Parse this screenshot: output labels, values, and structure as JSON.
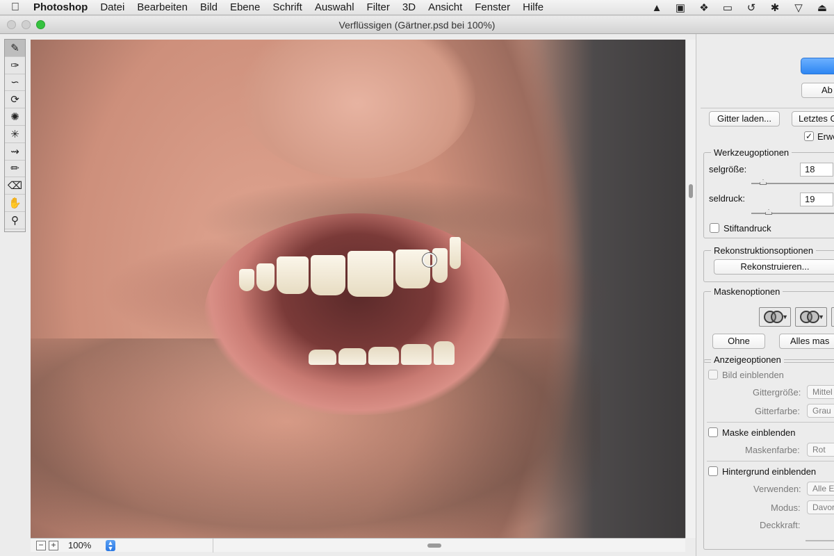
{
  "menubar": {
    "app_name": "Photoshop",
    "items": [
      "Datei",
      "Bearbeiten",
      "Bild",
      "Ebene",
      "Schrift",
      "Auswahl",
      "Filter",
      "3D",
      "Ansicht",
      "Fenster",
      "Hilfe"
    ],
    "status_icons": [
      "hat-icon",
      "display-icon",
      "dropbox-icon",
      "airplay-icon",
      "time-machine-icon",
      "bluetooth-icon",
      "wifi-icon",
      "eject-icon"
    ]
  },
  "window": {
    "title": "Verflüssigen (Gärtner.psd bei 100%)"
  },
  "toolbox": {
    "tools": [
      "forward-warp-tool-icon",
      "reconstruct-tool-icon",
      "smooth-tool-icon",
      "twirl-tool-icon",
      "pucker-tool-icon",
      "bloat-tool-icon",
      "push-left-tool-icon",
      "freeze-mask-tool-icon",
      "thaw-mask-tool-icon",
      "hand-tool-icon",
      "zoom-tool-icon"
    ]
  },
  "statusbar": {
    "zoom_minus": "−",
    "zoom_plus": "+",
    "zoom_value": "100%"
  },
  "panel": {
    "cancel_label": "Ab",
    "load_mesh_label": "Gitter laden...",
    "last_mesh_label": "Letztes G",
    "advanced_mode_label": "Erwe",
    "tool_options": {
      "legend": "Werkzeugoptionen",
      "brush_size_label": "selgröße:",
      "brush_size_value": "18",
      "brush_pressure_label": "seldruck:",
      "brush_pressure_value": "19",
      "stylus_pressure_label": "Stiftandruck"
    },
    "reconstruct_options": {
      "legend": "Rekonstruktionsoptionen",
      "reconstruct_label": "Rekonstruieren..."
    },
    "mask_options": {
      "legend": "Maskenoptionen",
      "none_label": "Ohne",
      "mask_all_label": "Alles mas"
    },
    "view_options": {
      "legend": "Anzeigeoptionen",
      "show_image_label": "Bild einblenden",
      "mesh_size_label": "Gittergröße:",
      "mesh_size_value": "Mittel",
      "mesh_color_label": "Gitterfarbe:",
      "mesh_color_value": "Grau",
      "show_mask_label": "Maske einblenden",
      "mask_color_label": "Maskenfarbe:",
      "mask_color_value": "Rot",
      "show_backdrop_label": "Hintergrund einblenden",
      "use_label": "Verwenden:",
      "use_value": "Alle E",
      "mode_label": "Modus:",
      "mode_value": "Davor",
      "opacity_label": "Deckkraft:"
    }
  }
}
